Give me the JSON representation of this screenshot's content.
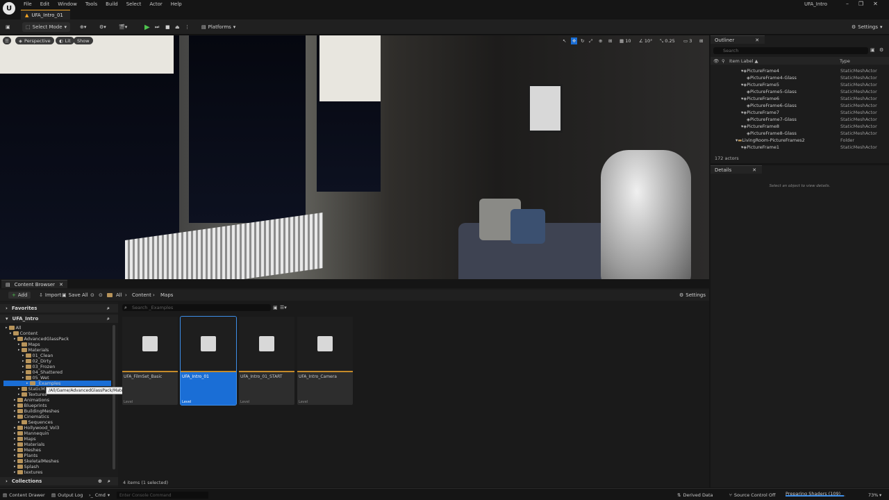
{
  "app": {
    "logo": "U",
    "window_title": "UFA_Intro",
    "level_tab": "UFA_Intro_01"
  },
  "menu": [
    "File",
    "Edit",
    "Window",
    "Tools",
    "Build",
    "Select",
    "Actor",
    "Help"
  ],
  "toolbar": {
    "select_mode": "Select Mode",
    "platforms": "Platforms",
    "settings": "Settings"
  },
  "viewport": {
    "perspective": "Perspective",
    "lit": "Lit",
    "show": "Show",
    "grid_value": "10",
    "angle_value": "10°",
    "scale_value": "0.25",
    "camera_speed": "3"
  },
  "outliner": {
    "tab": "Outliner",
    "search_placeholder": "Search",
    "col_label": "Item Label ▲",
    "col_type": "Type",
    "rows": [
      {
        "label": "PictureFrame4",
        "type": "StaticMeshActor",
        "indent": 2
      },
      {
        "label": "PictureFrame4-Glass",
        "type": "StaticMeshActor",
        "indent": 3
      },
      {
        "label": "PictureFrame5",
        "type": "StaticMeshActor",
        "indent": 2
      },
      {
        "label": "PictureFrame5-Glass",
        "type": "StaticMeshActor",
        "indent": 3
      },
      {
        "label": "PictureFrame6",
        "type": "StaticMeshActor",
        "indent": 2
      },
      {
        "label": "PictureFrame6-Glass",
        "type": "StaticMeshActor",
        "indent": 3
      },
      {
        "label": "PictureFrame7",
        "type": "StaticMeshActor",
        "indent": 2
      },
      {
        "label": "PictureFrame7-Glass",
        "type": "StaticMeshActor",
        "indent": 3
      },
      {
        "label": "PictureFrame8",
        "type": "StaticMeshActor",
        "indent": 2
      },
      {
        "label": "PictureFrame8-Glass",
        "type": "StaticMeshActor",
        "indent": 3
      },
      {
        "label": "LivingRoom-PictureFrames2",
        "type": "Folder",
        "indent": 1
      },
      {
        "label": "PictureFrame1",
        "type": "StaticMeshActor",
        "indent": 2
      }
    ],
    "count": "172 actors"
  },
  "details": {
    "tab": "Details",
    "empty": "Select an object to view details."
  },
  "content_browser": {
    "tab": "Content Browser",
    "add": "Add",
    "import": "Import",
    "save_all": "Save All",
    "path": [
      "All",
      "Content",
      "Maps"
    ],
    "settings": "Settings",
    "favorites": "Favorites",
    "project": "UFA_Intro",
    "collections": "Collections",
    "search_placeholder": "Search _Examples",
    "tooltip": "/All/Game/AdvancedGlassPack/Materials/05_Wet/_Examples",
    "tree": [
      {
        "label": "All",
        "indent": 0
      },
      {
        "label": "Content",
        "indent": 1
      },
      {
        "label": "AdvancedGlassPack",
        "indent": 2
      },
      {
        "label": "Maps",
        "indent": 3
      },
      {
        "label": "Materials",
        "indent": 3
      },
      {
        "label": "01_Clean",
        "indent": 4
      },
      {
        "label": "02_Dirty",
        "indent": 4
      },
      {
        "label": "03_Frozen",
        "indent": 4
      },
      {
        "label": "04_Shattered",
        "indent": 4
      },
      {
        "label": "05_Wet",
        "indent": 4
      },
      {
        "label": "_Examples",
        "indent": 5
      },
      {
        "label": "StaticM",
        "indent": 3
      },
      {
        "label": "Textures",
        "indent": 3
      },
      {
        "label": "Animations",
        "indent": 2
      },
      {
        "label": "Blueprints",
        "indent": 2
      },
      {
        "label": "BuildingMeshes",
        "indent": 2
      },
      {
        "label": "Cinematics",
        "indent": 2
      },
      {
        "label": "Sequences",
        "indent": 3
      },
      {
        "label": "Hollywood_Vol3",
        "indent": 2
      },
      {
        "label": "Mannequin",
        "indent": 2
      },
      {
        "label": "Maps",
        "indent": 2
      },
      {
        "label": "Materials",
        "indent": 2
      },
      {
        "label": "Meshes",
        "indent": 2
      },
      {
        "label": "Plants",
        "indent": 2
      },
      {
        "label": "SkeletalMeshes",
        "indent": 2
      },
      {
        "label": "Splash",
        "indent": 2
      },
      {
        "label": "textures",
        "indent": 2
      }
    ],
    "assets": [
      {
        "name": "UFA_FilmSet_Basic",
        "kind": "Level",
        "selected": false
      },
      {
        "name": "UFA_Intro_01",
        "kind": "Level",
        "selected": true
      },
      {
        "name": "UFA_Intro_01_START",
        "kind": "Level",
        "selected": false
      },
      {
        "name": "UFA_Intro_Camera",
        "kind": "Level",
        "selected": false
      }
    ],
    "status": "4 items (1 selected)"
  },
  "statusbar": {
    "content_drawer": "Content Drawer",
    "output_log": "Output Log",
    "cmd": "Cmd",
    "console_placeholder": "Enter Console Command",
    "derived_data": "Derived Data",
    "source_control": "Source Control Off",
    "shaders": "Preparing Shaders (109)",
    "shaders_progress": 0.98,
    "zoom": "73%"
  },
  "colors": {
    "accent_blue": "#1a6ed6",
    "accent_orange": "#f5a623",
    "play_green": "#4fc44f"
  }
}
